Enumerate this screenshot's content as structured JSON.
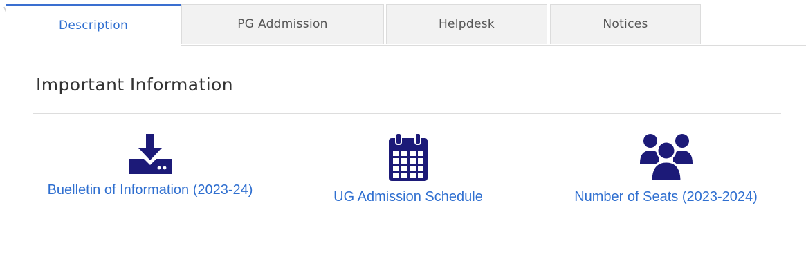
{
  "tabs": [
    {
      "label": "Description",
      "active": true
    },
    {
      "label": "PG Addmission",
      "active": false
    },
    {
      "label": "Helpdesk",
      "active": false
    },
    {
      "label": "Notices",
      "active": false
    }
  ],
  "section": {
    "title": "Important Information"
  },
  "items": [
    {
      "icon": "download-icon",
      "label": "Buelletin of Information (2023-24)"
    },
    {
      "icon": "calendar-icon",
      "label": "UG Admission Schedule"
    },
    {
      "icon": "users-icon",
      "label": "Number of Seats (2023-2024)"
    }
  ],
  "colors": {
    "accent": "#2f6fd0",
    "icon": "#1c1a78",
    "tab_active_border": "#3a6fd0",
    "tab_bg": "#f2f2f2"
  }
}
